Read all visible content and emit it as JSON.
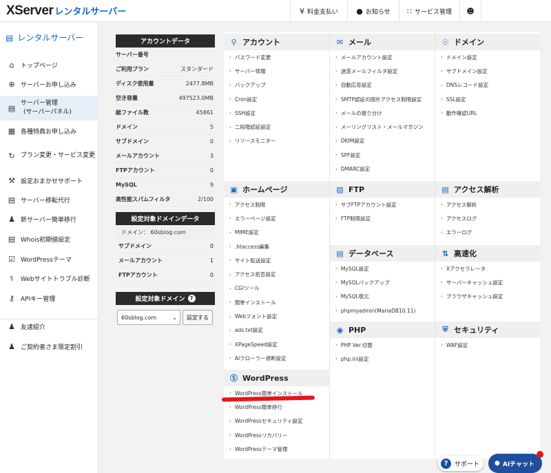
{
  "header": {
    "logo_main": "XServer",
    "logo_sub": "レンタルサーバー",
    "nav": [
      {
        "icon": "yen-circle-icon",
        "label": "料金支払い"
      },
      {
        "icon": "bell-icon",
        "label": "お知らせ"
      },
      {
        "icon": "grid-icon",
        "label": "サービス管理"
      },
      {
        "icon": "account-icon",
        "label": ""
      }
    ]
  },
  "sidebar": {
    "title": "レンタルサーバー",
    "items": [
      {
        "icon": "home-icon",
        "label": "トップページ"
      },
      {
        "icon": "plus-circle-icon",
        "label": "サーバーお申し込み"
      },
      {
        "icon": "server-icon",
        "label": "サーバー管理",
        "sub": "(サーバーパネル)"
      },
      {
        "icon": "gift-icon",
        "label": "各種特典お申し込み"
      },
      {
        "icon": "refresh-icon",
        "label": "プラン変更・サービス変更"
      },
      {
        "icon": "wrench-icon",
        "label": "設定おまかせサポート"
      },
      {
        "icon": "server-move-icon",
        "label": "サーバー移転代行"
      },
      {
        "icon": "people-icon",
        "label": "新サーバー簡単移行"
      },
      {
        "icon": "whois-icon",
        "label": "Whois初期値設定"
      },
      {
        "icon": "wordpress-theme-icon",
        "label": "WordPressテーマ"
      },
      {
        "icon": "stethoscope-icon",
        "label": "Webサイトトラブル診断"
      },
      {
        "icon": "key-icon",
        "label": "APIキー管理"
      },
      {
        "icon": "friend-icon",
        "label": "友達紹介"
      },
      {
        "icon": "discount-icon",
        "label": "ご契約者さま限定割引"
      }
    ]
  },
  "account": {
    "title": "アカウントデータ",
    "rows": [
      {
        "k": "サーバー番号",
        "v": ""
      },
      {
        "k": "ご利用プラン",
        "v": "スタンダード"
      },
      {
        "k": "ディスク使用量",
        "v": "2477.8MB"
      },
      {
        "k": "空き容量",
        "v": "497523.0MB"
      },
      {
        "k": "総ファイル数",
        "v": "45861"
      },
      {
        "k": "ドメイン",
        "v": "5"
      },
      {
        "k": "サブドメイン",
        "v": "0"
      },
      {
        "k": "メールアカウント",
        "v": "3"
      },
      {
        "k": "FTPアカウント",
        "v": "0"
      },
      {
        "k": "MySQL",
        "v": "9"
      },
      {
        "k": "高性能スパムフィルタ",
        "v": "2/100"
      }
    ]
  },
  "domain_data": {
    "title": "設定対象ドメインデータ",
    "domain_line": "ドメイン： 60sblog.com",
    "rows": [
      {
        "k": "サブドメイン",
        "v": "0"
      },
      {
        "k": "メールアカウント",
        "v": "1"
      },
      {
        "k": "FTPアカウント",
        "v": "0"
      }
    ]
  },
  "domain_select": {
    "title": "設定対象ドメイン",
    "selected": "60sblog.com",
    "button": "設定する"
  },
  "menu": {
    "account": {
      "title": "アカウント",
      "icon": "user-icon",
      "items": [
        "パスワード変更",
        "サーバー情報",
        "バックアップ",
        "Cron設定",
        "SSH設定",
        "二段階認証設定",
        "リソースモニター"
      ]
    },
    "homepage": {
      "title": "ホームページ",
      "icon": "window-icon",
      "items": [
        "アクセス制限",
        "エラーページ設定",
        "MIME設定",
        ".htaccess編集",
        "サイト転送設定",
        "アクセス拒否設定",
        "CGIツール",
        "簡単インストール",
        "Webフォント設定",
        "ads.txt設定",
        "XPageSpeed設定",
        "AIクローラー遮断設定"
      ]
    },
    "wordpress": {
      "title": "WordPress",
      "icon": "wordpress-icon",
      "items": [
        "WordPress簡単インストール",
        "WordPress簡単移行",
        "WordPressセキュリティ設定",
        "WordPressリカバリー",
        "WordPressテーマ管理"
      ]
    },
    "mail": {
      "title": "メール",
      "icon": "mail-icon",
      "items": [
        "メールアカウント設定",
        "迷惑メールフィルタ設定",
        "自動応答設定",
        "SMTP認証の国外アクセス制限設定",
        "メールの振り分け",
        "メーリングリスト・メールマガジン",
        "DKIM設定",
        "SPF設定",
        "DMARC設定"
      ]
    },
    "ftp": {
      "title": "FTP",
      "icon": "ftp-icon",
      "items": [
        "サブFTPアカウント設定",
        "FTP制限設定"
      ]
    },
    "database": {
      "title": "データベース",
      "icon": "database-icon",
      "items": [
        "MySQL設定",
        "MySQLバックアップ",
        "MySQL復元",
        "phpmyadmin(MariaDB10.11)"
      ]
    },
    "php": {
      "title": "PHP",
      "icon": "php-icon",
      "items": [
        "PHP Ver.切替",
        "php.ini設定"
      ]
    },
    "domain": {
      "title": "ドメイン",
      "icon": "globe-icon",
      "items": [
        "ドメイン設定",
        "サブドメイン設定",
        "DNSレコード設定",
        "SSL設定",
        "動作確認URL"
      ]
    },
    "analytics": {
      "title": "アクセス解析",
      "icon": "chart-icon",
      "items": [
        "アクセス解析",
        "アクセスログ",
        "エラーログ"
      ]
    },
    "speed": {
      "title": "高速化",
      "icon": "speed-icon",
      "items": [
        "Xアクセラレータ",
        "サーバーキャッシュ設定",
        "ブラウザキャッシュ設定"
      ]
    },
    "security": {
      "title": "セキュリティ",
      "icon": "shield-icon",
      "items": [
        "WAF設定"
      ]
    }
  },
  "floating": {
    "support": "サポート",
    "aichat": "AIチャット"
  },
  "colors": {
    "accent": "#1666c5",
    "dark": "#2b2b2b",
    "highlight": "#e8141b",
    "chat": "#1f4e9c"
  }
}
